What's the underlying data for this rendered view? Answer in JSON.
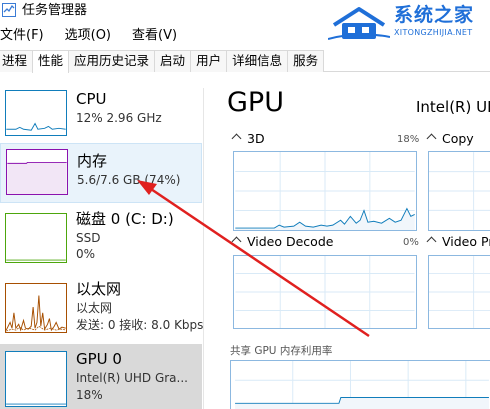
{
  "window": {
    "title": "任务管理器"
  },
  "watermark": {
    "title": "系统之家",
    "subtitle": "XITONGZHIJIA.NET"
  },
  "menu": [
    "文件(F)",
    "选项(O)",
    "查看(V)"
  ],
  "tabs": [
    {
      "label": "进程",
      "active": false
    },
    {
      "label": "性能",
      "active": true
    },
    {
      "label": "应用历史记录",
      "active": false
    },
    {
      "label": "启动",
      "active": false
    },
    {
      "label": "用户",
      "active": false
    },
    {
      "label": "详细信息",
      "active": false
    },
    {
      "label": "服务",
      "active": false
    }
  ],
  "sidebar": {
    "cpu": {
      "name": "CPU",
      "detail": "12% 2.96 GHz"
    },
    "memory": {
      "name": "内存",
      "detail": "5.6/7.6 GB (74%)"
    },
    "disk": {
      "name": "磁盘 0 (C: D:)",
      "type": "SSD",
      "usage": "0%"
    },
    "ethernet": {
      "name": "以太网",
      "sub": "以太网",
      "rates": "发送: 0 接收: 8.0 Kbps"
    },
    "gpu": {
      "name": "GPU 0",
      "model": "Intel(R) UHD Gra...",
      "usage": "18%"
    }
  },
  "main": {
    "title": "GPU",
    "model": "Intel(R) UHD",
    "engines": [
      {
        "name": "3D",
        "pct": "18%"
      },
      {
        "name": "Copy",
        "pct": ""
      },
      {
        "name": "Video Decode",
        "pct": "0%"
      },
      {
        "name": "Video Pr",
        "pct": ""
      }
    ],
    "shared_memory_label": "共享 GPU 内存利用率"
  },
  "colors": {
    "cpu": "#117dbb",
    "memory": "#8b12ae",
    "disk": "#4da60c",
    "ethernet": "#a74f01",
    "gpu": "#117dbb",
    "annotation_arrow": "#e0201f"
  }
}
